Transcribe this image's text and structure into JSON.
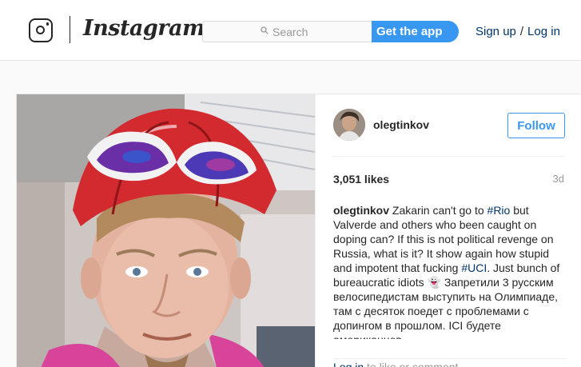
{
  "header": {
    "wordmark": "Instagram",
    "search_placeholder": "Search",
    "get_app_label": "Get the app",
    "sign_up_label": "Sign up",
    "separator": "/",
    "log_in_label": "Log in"
  },
  "post": {
    "username": "olegtinkov",
    "follow_label": "Follow",
    "likes": "3,051 likes",
    "age": "3d",
    "caption": {
      "username": "olegtinkov",
      "text_1": " Zakarin can't go to ",
      "tag_rio": "#Rio",
      "text_2": " but Valverde and others who been caught on doping can? If this is not political revenge on Russia, what is it? It show again how stupid and impotent that fucking ",
      "tag_uci": "#UCI",
      "text_3": ". Just bunch of bureaucratic idiots 👻 Запретили 3 русским велосипедистам выступить на Олимпиаде, там с десяток поедет с проблемами с допингом в прошлом. ICI будете американцев"
    },
    "login_link": "Log in",
    "login_suffix": " to like or comment.",
    "more_dots": "•••"
  },
  "colors": {
    "brand_blue": "#3897f0",
    "link_dark_blue": "#003569",
    "text": "#262626",
    "muted": "#999999"
  },
  "icons": [
    "instagram-glyph-icon",
    "search-icon",
    "more-options-icon"
  ]
}
